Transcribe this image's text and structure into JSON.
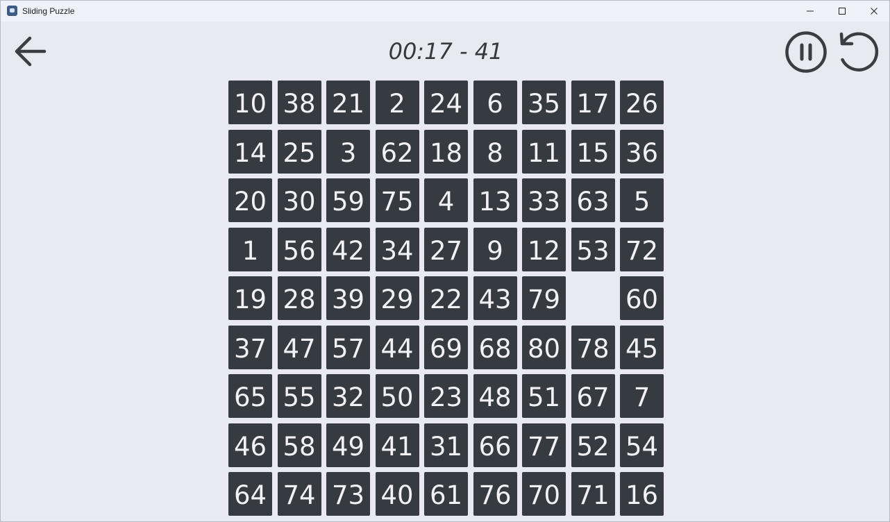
{
  "window": {
    "title": "Sliding Puzzle",
    "icon": "app-puzzle-icon"
  },
  "controls": {
    "back_icon": "arrow-left-icon",
    "pause_icon": "pause-circle-icon",
    "restart_icon": "restart-icon"
  },
  "status": {
    "text": "00:17 - 41"
  },
  "colors": {
    "background": "#e9e9f2",
    "tile": "#363b42",
    "tile_text": "#f1f2f6",
    "icon": "#3b3d42"
  },
  "board": {
    "size": 9,
    "tiles": [
      [
        "10",
        "38",
        "21",
        "2",
        "24",
        "6",
        "35",
        "17",
        "26"
      ],
      [
        "14",
        "25",
        "3",
        "62",
        "18",
        "8",
        "11",
        "15",
        "36"
      ],
      [
        "20",
        "30",
        "59",
        "75",
        "4",
        "13",
        "33",
        "63",
        "5"
      ],
      [
        "1",
        "56",
        "42",
        "34",
        "27",
        "9",
        "12",
        "53",
        "72"
      ],
      [
        "19",
        "28",
        "39",
        "29",
        "22",
        "43",
        "79",
        "",
        "60"
      ],
      [
        "37",
        "47",
        "57",
        "44",
        "69",
        "68",
        "80",
        "78",
        "45"
      ],
      [
        "65",
        "55",
        "32",
        "50",
        "23",
        "48",
        "51",
        "67",
        "7"
      ],
      [
        "46",
        "58",
        "49",
        "41",
        "31",
        "66",
        "77",
        "52",
        "54"
      ],
      [
        "64",
        "74",
        "73",
        "40",
        "61",
        "76",
        "70",
        "71",
        "16"
      ]
    ]
  }
}
